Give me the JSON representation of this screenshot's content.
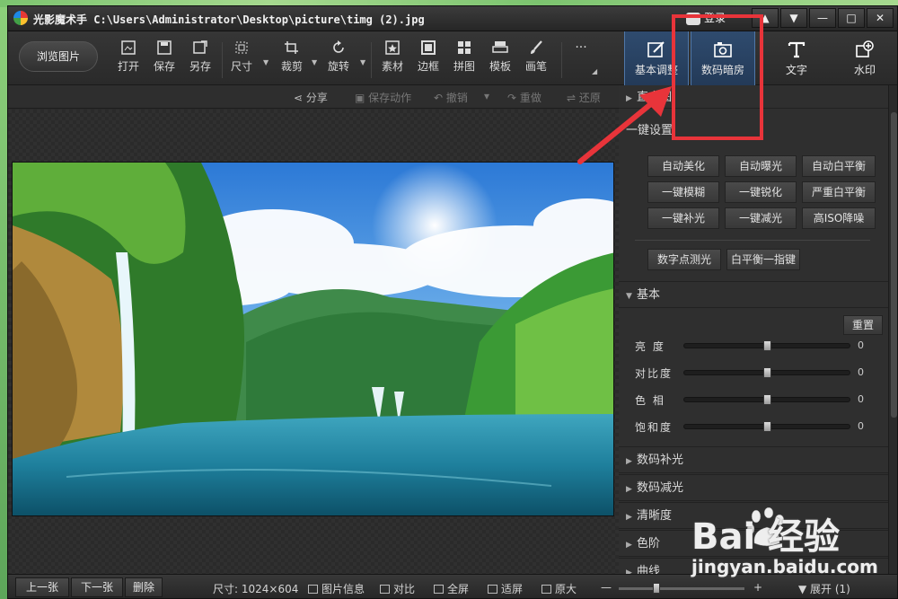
{
  "window": {
    "title": "光影魔术手  C:\\Users\\Administrator\\Desktop\\picture\\timg (2).jpg",
    "login_label": "登录"
  },
  "window_controls": {
    "up": "▲",
    "down": "▼",
    "minimize": "—",
    "maximize": "□",
    "close": "✕"
  },
  "toolbar": {
    "browse_label": "浏览图片",
    "tools": [
      "打开",
      "保存",
      "另存",
      "尺寸",
      "裁剪",
      "旋转",
      "素材",
      "边框",
      "拼图",
      "模板",
      "画笔"
    ],
    "more_label": "···"
  },
  "right_tabs": {
    "items": [
      "基本调整",
      "数码暗房",
      "文字",
      "水印"
    ],
    "active": "数码暗房"
  },
  "actionbar": {
    "share": "分享",
    "save_action": "保存动作",
    "undo": "撤销",
    "redo": "重做",
    "restore": "还原"
  },
  "panel": {
    "histogram_label": "直方图",
    "one_click_label": "一键设置",
    "one_click_buttons": [
      "自动美化",
      "自动曝光",
      "自动白平衡",
      "一键模糊",
      "一键锐化",
      "严重白平衡",
      "一键补光",
      "一键减光",
      "高ISO降噪"
    ],
    "extra_buttons": [
      "数字点测光",
      "白平衡一指键"
    ],
    "basic_label": "基本",
    "reset_label": "重置",
    "sliders": [
      {
        "label": "亮  度",
        "value": "0",
        "level": 0.5
      },
      {
        "label": "对比度",
        "value": "0",
        "level": 0.5
      },
      {
        "label": "色  相",
        "value": "0",
        "level": 0.5
      },
      {
        "label": "饱和度",
        "value": "0",
        "level": 0.5
      }
    ],
    "collapsed_sections": [
      "数码补光",
      "数码减光",
      "清晰度",
      "色阶",
      "曲线"
    ]
  },
  "bottombar": {
    "prev": "上一张",
    "next": "下一张",
    "delete": "删除",
    "size": "尺寸: 1024×604",
    "info": "图片信息",
    "compare": "对比",
    "fullscreen": "全屏",
    "fit": "适屏",
    "original": "原大",
    "zoom_minus": "—",
    "zoom_plus": "+",
    "expand": "展开 (1)"
  },
  "watermark": {
    "logo": "Bai 经验",
    "url": "jingyan.baidu.com"
  },
  "colors": {
    "accent_red": "#e8343a",
    "active_tab": "#2f4b6e"
  }
}
